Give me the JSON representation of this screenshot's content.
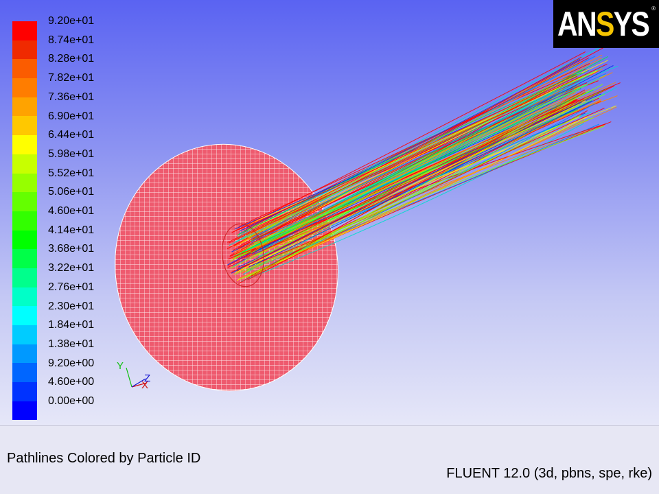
{
  "colormap": {
    "labels": [
      "9.20e+01",
      "8.74e+01",
      "8.28e+01",
      "7.82e+01",
      "7.36e+01",
      "6.90e+01",
      "6.44e+01",
      "5.98e+01",
      "5.52e+01",
      "5.06e+01",
      "4.60e+01",
      "4.14e+01",
      "3.68e+01",
      "3.22e+01",
      "2.76e+01",
      "2.30e+01",
      "1.84e+01",
      "1.38e+01",
      "9.20e+00",
      "4.60e+00",
      "0.00e+00"
    ],
    "colors": [
      "#ff0000",
      "#f02a00",
      "#fb5c00",
      "#ff7d00",
      "#ffa300",
      "#ffc800",
      "#ffff00",
      "#c8ff00",
      "#96ff00",
      "#64ff00",
      "#32ff00",
      "#00ff00",
      "#00ff48",
      "#00ff8c",
      "#00ffc8",
      "#00ffff",
      "#00ccff",
      "#0099ff",
      "#0066ff",
      "#0033ff",
      "#0000ff"
    ]
  },
  "logo": {
    "prefix": "AN",
    "highlight": "S",
    "suffix": "YS",
    "registered": "®"
  },
  "axes": {
    "x": "X",
    "y": "Y",
    "z": "Z",
    "x_color": "#d01010",
    "y_color": "#10c010",
    "z_color": "#1010d0"
  },
  "scene": {
    "disk_color": "#ee5a6e",
    "mesh_color": "#ffffff",
    "pathline_colors": [
      "#ff0000",
      "#ff8800",
      "#ffee00",
      "#88ff00",
      "#00ee44",
      "#00ddcc",
      "#0088ff",
      "#0033ee"
    ]
  },
  "caption": {
    "title": "Pathlines Colored by Particle ID",
    "solver": "FLUENT 12.0 (3d, pbns, spe, rke)"
  }
}
